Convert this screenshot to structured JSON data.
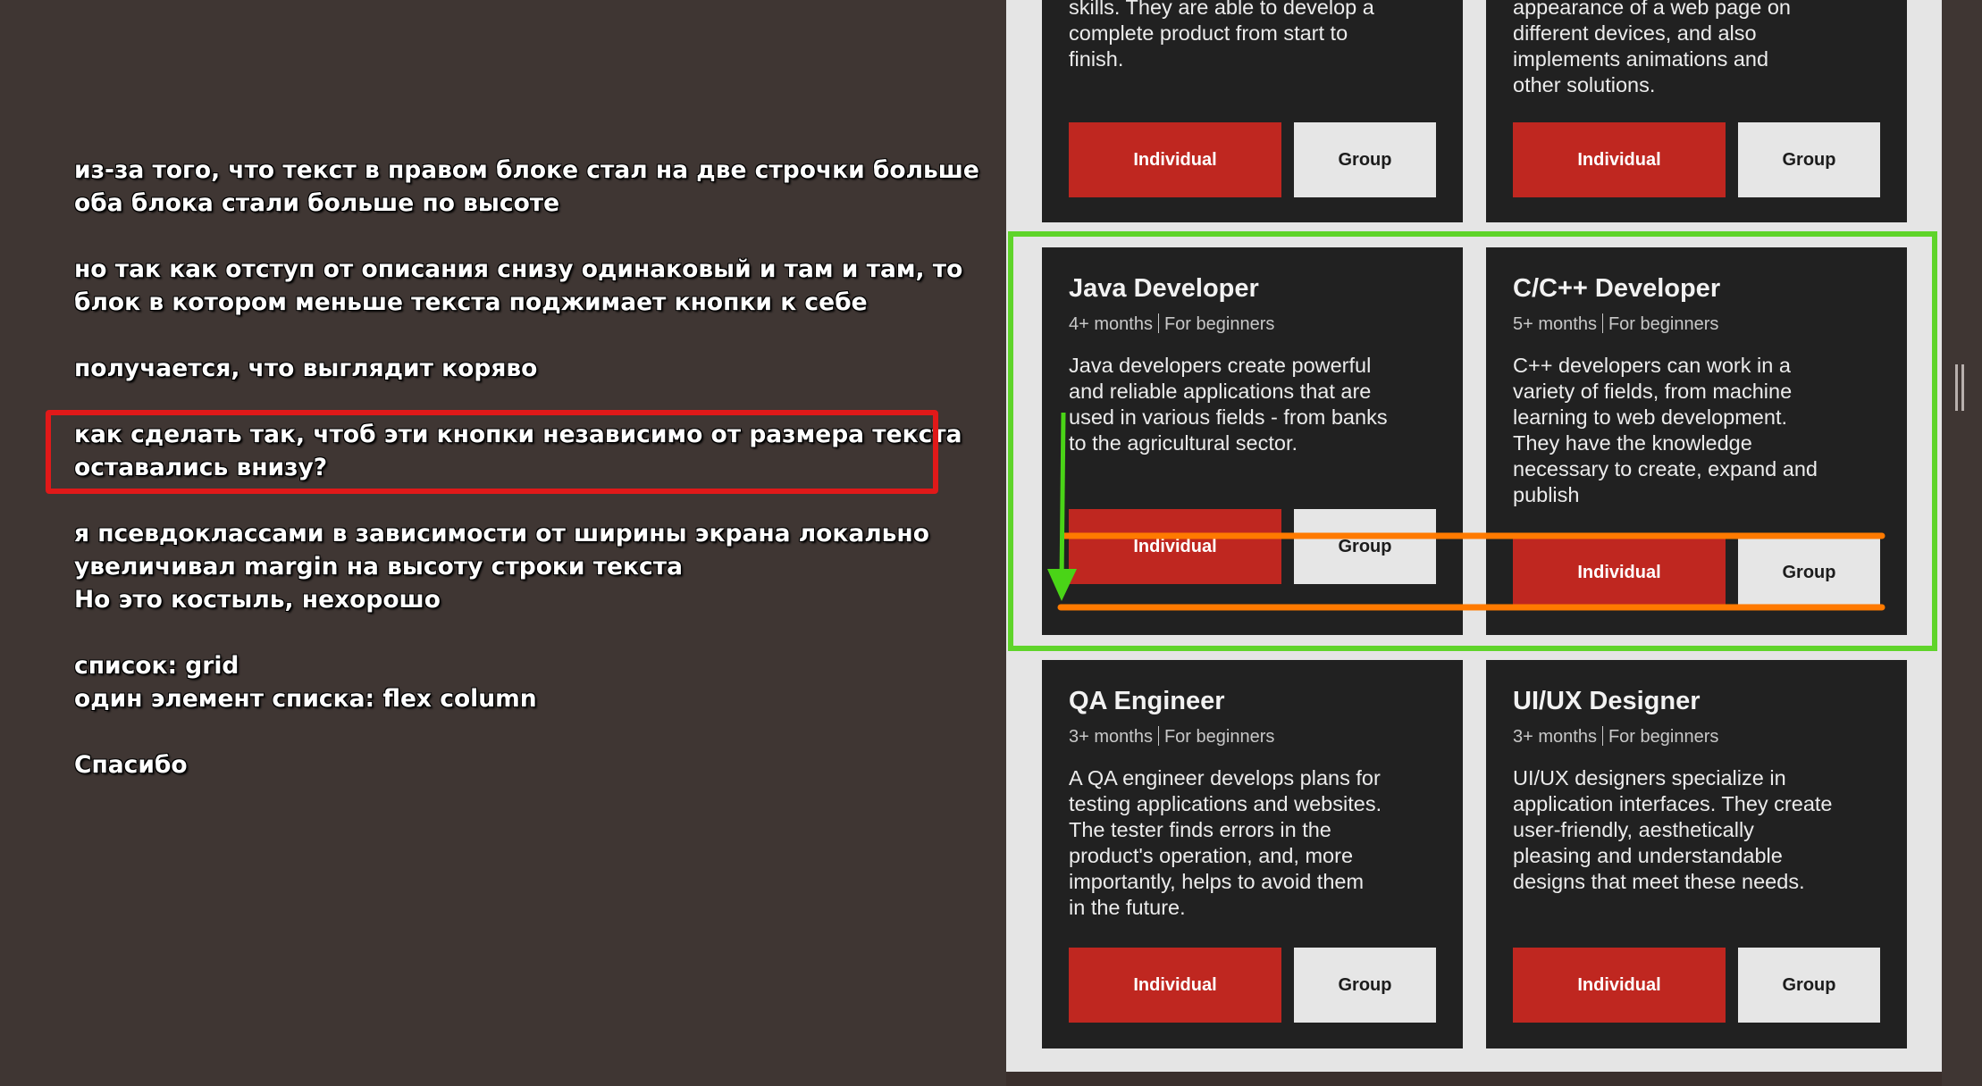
{
  "notes": {
    "paragraphs": [
      [
        "из-за того, что текст в правом блоке стал на две строчки больше",
        "оба блока стали больше по высоте"
      ],
      [
        "но так как отступ от описания снизу одинаковый и там и там, то",
        "блок в котором меньше текста поджимает кнопки к себе"
      ],
      [
        "получается, что выглядит коряво"
      ],
      [
        "как сделать так, чтоб эти кнопки независимо от размера текста",
        "оставались внизу?"
      ],
      [
        "я псевдоклассами в зависимости от ширины экрана локально",
        "увеличивал margin на высоту строки текста",
        "Но это костыль, нехорошо"
      ],
      [
        "список: grid",
        "один элемент списка: flex column"
      ],
      [
        "Спасибо"
      ]
    ]
  },
  "cards": {
    "top_left": {
      "desc_lines": [
        "skills. They are able to develop a",
        "complete product from start to",
        "finish."
      ]
    },
    "top_right": {
      "desc_lines": [
        "appearance of a web page on",
        "different devices, and also",
        "implements animations and",
        "other solutions."
      ]
    },
    "java": {
      "title": "Java Developer",
      "duration": "4+ months",
      "level": "For beginners",
      "desc_lines": [
        "Java developers create powerful",
        "and reliable applications that are",
        "used in various fields - from banks",
        "to the agricultural sector."
      ]
    },
    "cpp": {
      "title": "C/C++ Developer",
      "duration": "5+ months",
      "level": "For beginners",
      "desc_lines": [
        "C++ developers can work in a",
        "variety of fields, from machine",
        "learning to web development.",
        "They have the knowledge",
        "necessary to create, expand and",
        "publish"
      ]
    },
    "qa": {
      "title": "QA Engineer",
      "duration": "3+ months",
      "level": "For beginners",
      "desc_lines": [
        "A QA engineer develops plans for",
        "testing applications and websites.",
        "The tester finds errors in the",
        "product's operation, and, more",
        "importantly, helps to avoid them",
        "in the future."
      ]
    },
    "uiux": {
      "title": "UI/UX Designer",
      "duration": "3+ months",
      "level": "For beginners",
      "desc_lines": [
        "UI/UX designers specialize in",
        "application interfaces. They create",
        "user-friendly, aesthetically",
        "pleasing and understandable",
        "designs that meet these needs."
      ]
    }
  },
  "buttons": {
    "individual": "Individual",
    "group": "Group"
  },
  "colors": {
    "highlight_red": "#e01919",
    "highlight_green": "#5fd42a",
    "highlight_orange": "#ff7a00",
    "button_red": "#bf2720"
  }
}
